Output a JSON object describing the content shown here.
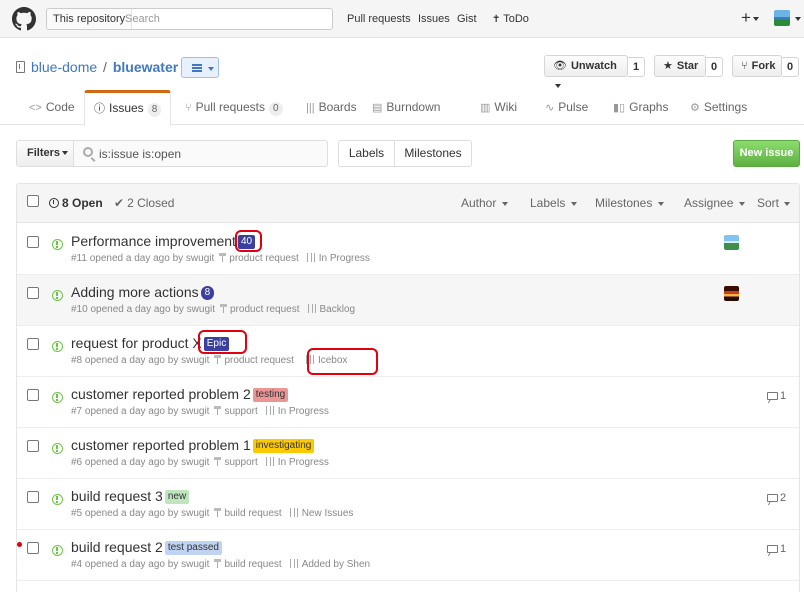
{
  "header": {
    "scope_label": "This repository",
    "search_placeholder": "Search",
    "nav": [
      "Pull requests",
      "Issues",
      "Gist",
      "ToDo"
    ],
    "plus": "+"
  },
  "repo": {
    "owner": "blue-dome",
    "separator": "/",
    "name": "bluewater",
    "watch": {
      "label": "Unwatch",
      "count": "1"
    },
    "star": {
      "label": "Star",
      "count": "0"
    },
    "fork": {
      "label": "Fork",
      "count": "0"
    }
  },
  "tabs": [
    {
      "label": "Code",
      "icon": "code-icon"
    },
    {
      "label": "Issues",
      "count": "8",
      "icon": "issue-opened-icon",
      "selected": true
    },
    {
      "label": "Pull requests",
      "count": "0",
      "icon": "pull-request-icon"
    },
    {
      "label": "Boards",
      "icon": "boards-icon"
    },
    {
      "label": "Burndown",
      "icon": "burndown-icon"
    },
    {
      "label": "Wiki",
      "icon": "book-icon"
    },
    {
      "label": "Pulse",
      "icon": "pulse-icon"
    },
    {
      "label": "Graphs",
      "icon": "graph-icon"
    },
    {
      "label": "Settings",
      "icon": "gear-icon"
    }
  ],
  "filter": {
    "button": "Filters",
    "value": "is:issue is:open",
    "labels": "Labels",
    "milestones": "Milestones",
    "new_issue": "New issue"
  },
  "list_header": {
    "open": "8 Open",
    "closed": "2 Closed",
    "author": "Author",
    "labels": "Labels",
    "milestones": "Milestones",
    "assignee": "Assignee",
    "sort": "Sort"
  },
  "issues": [
    {
      "title": "Performance improvement",
      "label": "40",
      "label_bg": "#3b3f9e",
      "label_fg": "#ffffff",
      "meta": "#11 opened a day ago by swugit",
      "milestone": "product request",
      "project": "In Progress",
      "comments": "",
      "assignee": "avatar-landscape"
    },
    {
      "title": "Adding more actions",
      "label": "8",
      "label_bg": "#3b3f9e",
      "label_fg": "#ffffff",
      "meta": "#10 opened a day ago by swugit",
      "milestone": "product request",
      "project": "Backlog",
      "comments": "",
      "assignee": "avatar-sunset"
    },
    {
      "title": "request for product X",
      "label": "Epic",
      "label_bg": "#3b3f9e",
      "label_fg": "#ffffff",
      "meta": "#8 opened a day ago by swugit",
      "milestone": "product request",
      "project": "Icebox",
      "comments": ""
    },
    {
      "title": "customer reported problem 2",
      "label": "testing",
      "label_bg": "#e99695",
      "label_fg": "#333333",
      "meta": "#7 opened a day ago by swugit",
      "milestone": "support",
      "project": "In Progress",
      "comments": "1"
    },
    {
      "title": "customer reported problem 1",
      "label": "investigating",
      "label_bg": "#fbca04",
      "label_fg": "#333333",
      "meta": "#6 opened a day ago by swugit",
      "milestone": "support",
      "project": "In Progress",
      "comments": ""
    },
    {
      "title": "build request 3",
      "label": "new",
      "label_bg": "#bfe5bf",
      "label_fg": "#333333",
      "meta": "#5 opened a day ago by swugit",
      "milestone": "build request",
      "project": "New Issues",
      "comments": "2"
    },
    {
      "title": "build request 2",
      "label": "test passed",
      "label_bg": "#bfd4f2",
      "label_fg": "#333333",
      "meta": "#4 opened a day ago by swugit",
      "milestone": "build request",
      "project": "Added by Shen",
      "comments": "1"
    }
  ]
}
